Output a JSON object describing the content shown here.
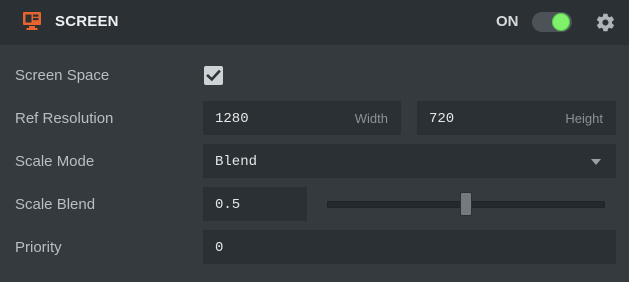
{
  "header": {
    "icon": "screen-icon",
    "title": "SCREEN",
    "toggle_label": "ON",
    "toggle_on": true,
    "settings_icon": "gear-icon"
  },
  "rows": {
    "screen_space": {
      "label": "Screen Space",
      "checked": true
    },
    "ref_resolution": {
      "label": "Ref Resolution",
      "width_value": "1280",
      "width_label": "Width",
      "height_value": "720",
      "height_label": "Height"
    },
    "scale_mode": {
      "label": "Scale Mode",
      "value": "Blend"
    },
    "scale_blend": {
      "label": "Scale Blend",
      "value": "0.5",
      "slider_fraction": 0.5
    },
    "priority": {
      "label": "Priority",
      "value": "0"
    }
  },
  "colors": {
    "accent": "#e8642c",
    "toggle_on": "#7ff16a",
    "panel_bg": "#343a3e",
    "header_bg": "#2a3034",
    "field_bg": "#2a3034"
  }
}
